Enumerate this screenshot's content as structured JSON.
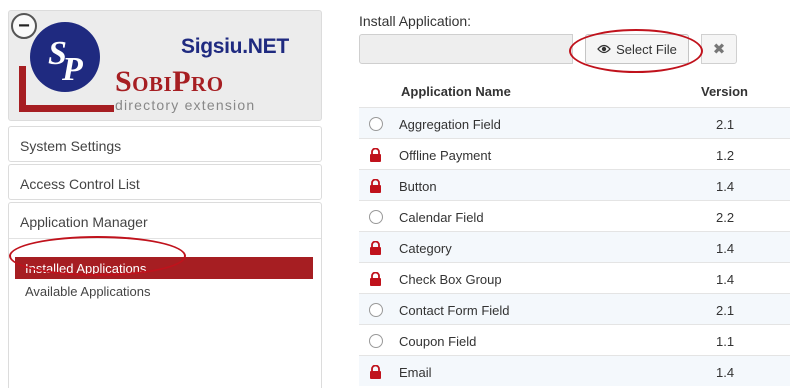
{
  "sidebar": {
    "logo": {
      "brand_net": "Sigsiu.NET",
      "brand_name": "SobiPro",
      "tagline": "directory extension",
      "monogram": "SP"
    },
    "collapse_symbol": "−",
    "system_settings": "System Settings",
    "access_control": "Access Control List",
    "app_manager": "Application Manager",
    "installed_apps": "Installed Applications",
    "available_apps": "Available Applications"
  },
  "install": {
    "label": "Install Application:",
    "file_value": "",
    "select_label": "Select File",
    "select_icon": "eye-icon",
    "clear_icon": "close-icon",
    "clear_symbol": "✖"
  },
  "table": {
    "col_name": "Application Name",
    "col_version": "Version",
    "rows": [
      {
        "name": "Aggregation Field",
        "version": "2.1",
        "icon": "radio"
      },
      {
        "name": "Offline Payment",
        "version": "1.2",
        "icon": "lock"
      },
      {
        "name": "Button",
        "version": "1.4",
        "icon": "lock"
      },
      {
        "name": "Calendar Field",
        "version": "2.2",
        "icon": "radio"
      },
      {
        "name": "Category",
        "version": "1.4",
        "icon": "lock"
      },
      {
        "name": "Check Box Group",
        "version": "1.4",
        "icon": "lock"
      },
      {
        "name": "Contact Form Field",
        "version": "2.1",
        "icon": "radio"
      },
      {
        "name": "Coupon Field",
        "version": "1.1",
        "icon": "radio"
      },
      {
        "name": "Email",
        "version": "1.4",
        "icon": "lock"
      }
    ]
  },
  "colors": {
    "accent_red": "#a61e22",
    "brand_blue": "#1f2a80",
    "annotation_red": "#c0121c"
  }
}
